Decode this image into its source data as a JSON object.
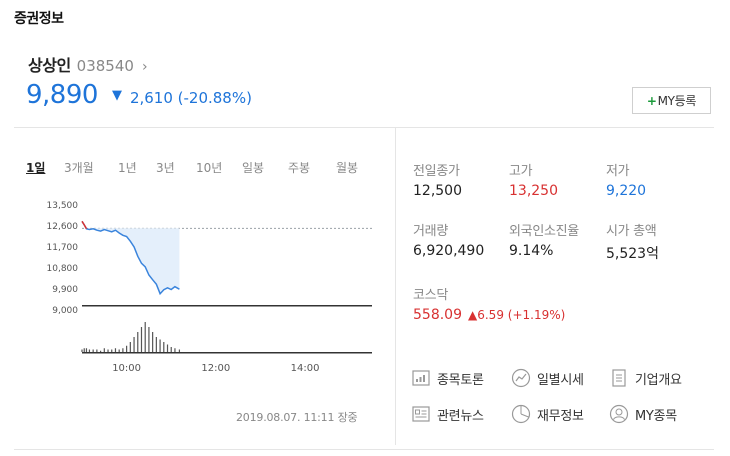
{
  "section_title": "증권정보",
  "stock": {
    "name": "상상인",
    "code": "038540",
    "price": "9,890",
    "change": "2,610 (-20.88%)",
    "my_button_plus": "+",
    "my_button_label": "MY등록"
  },
  "period_tabs": [
    "1일",
    "3개월",
    "1년",
    "3년",
    "10년",
    "일봉",
    "주봉",
    "월봉"
  ],
  "chart_data": {
    "type": "line",
    "y_ticks": [
      "13,500",
      "12,600",
      "11,700",
      "10,800",
      "9,900",
      "9,000"
    ],
    "x_ticks": [
      "10:00",
      "12:00",
      "14:00"
    ],
    "ylim": [
      9000,
      13500
    ],
    "reference_line": 12500,
    "series": [
      {
        "x": [
          "09:00",
          "09:03",
          "09:06",
          "09:10",
          "09:15",
          "09:20",
          "09:25",
          "09:30",
          "09:35",
          "09:40",
          "09:45",
          "09:50",
          "09:55",
          "10:00",
          "10:05",
          "10:10",
          "10:15",
          "10:20",
          "10:25",
          "10:30",
          "10:35",
          "10:40",
          "10:45",
          "10:50",
          "10:55",
          "11:00",
          "11:05",
          "11:11"
        ],
        "values": [
          12800,
          12650,
          12480,
          12450,
          12480,
          12420,
          12380,
          12450,
          12400,
          12350,
          12420,
          12300,
          12200,
          12150,
          11950,
          11700,
          11300,
          11000,
          10850,
          10500,
          10300,
          10100,
          9700,
          9870,
          9950,
          9880,
          10000,
          9890
        ]
      }
    ],
    "volume": [
      2,
      3,
      3,
      2,
      2,
      2,
      1,
      3,
      2,
      2,
      3,
      2,
      3,
      5,
      8,
      12,
      16,
      20,
      24,
      20,
      16,
      12,
      10,
      8,
      6,
      4,
      3,
      2
    ]
  },
  "timestamp": "2019.08.07. 11:11 장중",
  "info": {
    "prev_close_label": "전일종가",
    "prev_close": "12,500",
    "high_label": "고가",
    "high": "13,250",
    "low_label": "저가",
    "low": "9,220",
    "volume_label": "거래량",
    "volume": "6,920,490",
    "foreign_label": "외국인소진율",
    "foreign": "9.14%",
    "market_cap_label": "시가 총액",
    "market_cap": "5,523억",
    "kosdaq_label": "코스닥",
    "kosdaq_value": "558.09",
    "kosdaq_change": "▲6.59 (+1.19%)"
  },
  "links": {
    "discussion": "종목토론",
    "daily_price": "일별시세",
    "company": "기업개요",
    "news": "관련뉴스",
    "financial": "재무정보",
    "my_stocks": "MY종목"
  },
  "colors": {
    "down_blue": "#1e74d9",
    "up_red": "#d83131",
    "my_green": "#1a9a3a"
  }
}
